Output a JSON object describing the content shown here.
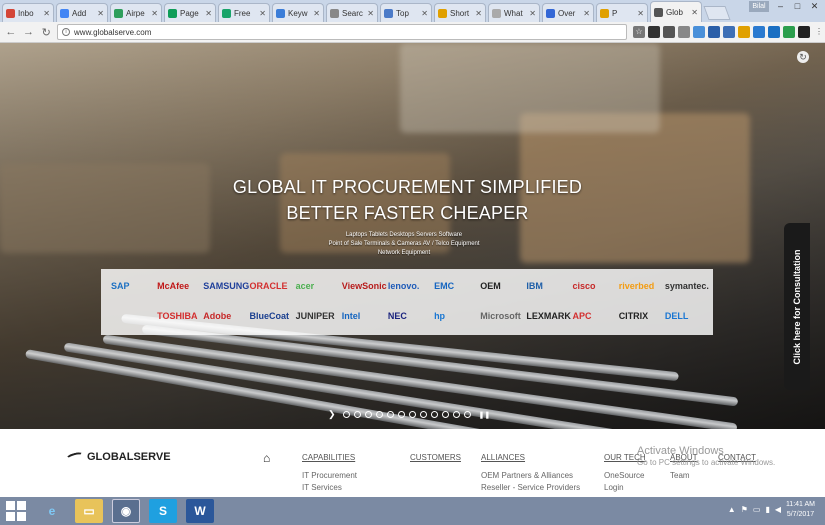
{
  "browser": {
    "tabs": [
      {
        "label": "Inbo",
        "color": "#d44638"
      },
      {
        "label": "Add",
        "color": "#4285f4"
      },
      {
        "label": "Airpe",
        "color": "#2e9e5b"
      },
      {
        "label": "Page",
        "color": "#0f9d58"
      },
      {
        "label": "Free",
        "color": "#18a46a"
      },
      {
        "label": "Keyw",
        "color": "#3b7dd8"
      },
      {
        "label": "Searc",
        "color": "#888888"
      },
      {
        "label": "Top",
        "color": "#4a7ac8"
      },
      {
        "label": "Short",
        "color": "#e0a000"
      },
      {
        "label": "What",
        "color": "#aaaaaa"
      },
      {
        "label": "Over",
        "color": "#3367d6"
      },
      {
        "label": "P",
        "color": "#e0a000"
      },
      {
        "label": "Glob",
        "color": "#555555"
      }
    ],
    "user_badge": "Bilal",
    "url": "www.globalserve.com"
  },
  "hero": {
    "title_line1": "GLOBAL IT PROCUREMENT SIMPLIFIED",
    "title_line2": "BETTER FASTER CHEAPER",
    "sub_line1": "Laptops Tablets Desktops Servers Software",
    "sub_line2": "Point of Sale Terminals & Cameras AV / Telco Equipment",
    "sub_line3": "Network Equipment",
    "consultation_label": "Click here for Consultation",
    "logos_row1": [
      {
        "name": "SAP",
        "color": "#1b6fc2"
      },
      {
        "name": "McAfee",
        "color": "#c01818"
      },
      {
        "name": "SAMSUNG",
        "color": "#1f3f9a"
      },
      {
        "name": "ORACLE",
        "color": "#d32f2f"
      },
      {
        "name": "acer",
        "color": "#4caf50"
      },
      {
        "name": "ViewSonic",
        "color": "#b71c1c"
      },
      {
        "name": "lenovo.",
        "color": "#1e5bb8"
      },
      {
        "name": "EMC",
        "color": "#1565c0"
      },
      {
        "name": "OEM",
        "color": "#222222"
      },
      {
        "name": "IBM",
        "color": "#1f5fa8"
      },
      {
        "name": "cisco",
        "color": "#c62828"
      },
      {
        "name": "riverbed",
        "color": "#f39c12"
      },
      {
        "name": "symantec.",
        "color": "#333333"
      }
    ],
    "logos_row2": [
      {
        "name": "",
        "color": "#888888"
      },
      {
        "name": "TOSHIBA",
        "color": "#d32f2f"
      },
      {
        "name": "Adobe",
        "color": "#c62828"
      },
      {
        "name": "BlueCoat",
        "color": "#1a3f8f"
      },
      {
        "name": "JUNIPER",
        "color": "#333333"
      },
      {
        "name": "Intel",
        "color": "#1565c0"
      },
      {
        "name": "NEC",
        "color": "#1a237e"
      },
      {
        "name": "hp",
        "color": "#1976d2"
      },
      {
        "name": "Microsoft",
        "color": "#666666"
      },
      {
        "name": "LEXMARK",
        "color": "#222222"
      },
      {
        "name": "APC",
        "color": "#d32f2f"
      },
      {
        "name": "CITRIX",
        "color": "#222222"
      },
      {
        "name": "DELL",
        "color": "#1976d2"
      }
    ],
    "slide_count": 12
  },
  "footer": {
    "brand": "GLOBALSERVE",
    "capabilities": {
      "head": "CAPABILITIES",
      "links": [
        "IT Procurement",
        "IT Services"
      ]
    },
    "customers": {
      "head": "CUSTOMERS"
    },
    "alliances": {
      "head": "ALLIANCES",
      "links": [
        "OEM Partners & Alliances",
        "Reseller - Service Providers"
      ]
    },
    "our_tech": {
      "head": "OUR TECH",
      "links": [
        "OneSource",
        "Login"
      ]
    },
    "about": {
      "head": "ABOUT",
      "links": [
        "Team"
      ]
    },
    "contact": {
      "head": "CONTACT"
    },
    "watermark_line1": "Activate Windows",
    "watermark_line2": "Go to PC settings to activate Windows."
  },
  "taskbar": {
    "time": "11:41 AM",
    "date": "5/7/2017"
  }
}
